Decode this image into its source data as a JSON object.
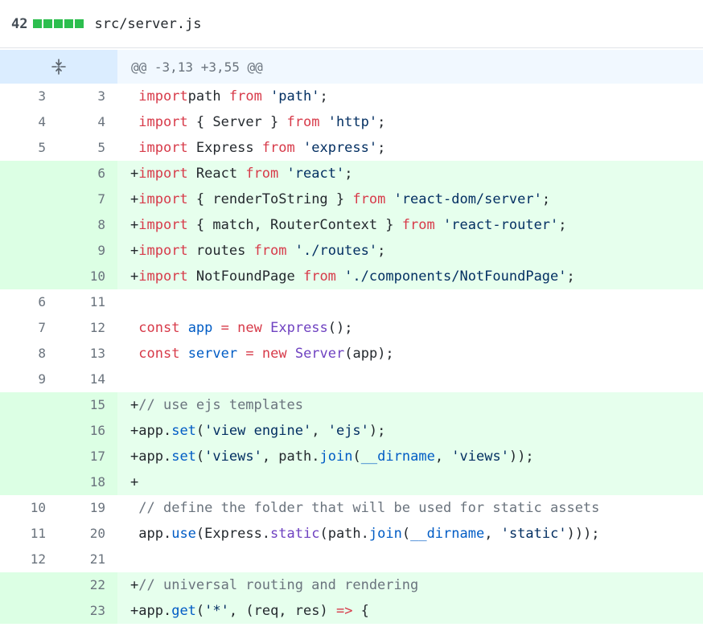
{
  "file": {
    "change_count": "42",
    "diffstat_blocks": 5,
    "diffstat_color": "#2cbe4e",
    "path": "src/server.js"
  },
  "hunk": {
    "header": "@@ -3,13 +3,55 @@",
    "expand_icon": "unfold-icon"
  },
  "colors": {
    "addition_bg": "#e6ffed",
    "addition_num_bg": "#dcffe4",
    "hunk_bg": "#f1f8ff",
    "keyword": "#d73a49",
    "string": "#032f62",
    "function": "#6f42c1",
    "comment": "#6a737d",
    "variable": "#005cc5"
  },
  "lines": [
    {
      "type": "ctx",
      "old": "3",
      "new": "3",
      "prefix": " ",
      "tokens": [
        [
          "k",
          "import"
        ],
        [
          "",
          "path "
        ],
        [
          "k",
          "from"
        ],
        [
          "",
          " "
        ],
        [
          "s",
          "'path'"
        ],
        [
          "",
          ";"
        ]
      ]
    },
    {
      "type": "ctx",
      "old": "4",
      "new": "4",
      "prefix": " ",
      "tokens": [
        [
          "k",
          "import"
        ],
        [
          "",
          " { Server } "
        ],
        [
          "k",
          "from"
        ],
        [
          "",
          " "
        ],
        [
          "s",
          "'http'"
        ],
        [
          "",
          ";"
        ]
      ]
    },
    {
      "type": "ctx",
      "old": "5",
      "new": "5",
      "prefix": " ",
      "tokens": [
        [
          "k",
          "import"
        ],
        [
          "",
          " Express "
        ],
        [
          "k",
          "from"
        ],
        [
          "",
          " "
        ],
        [
          "s",
          "'express'"
        ],
        [
          "",
          ";"
        ]
      ]
    },
    {
      "type": "add",
      "old": "",
      "new": "6",
      "prefix": "+",
      "tokens": [
        [
          "k",
          "import"
        ],
        [
          "",
          " React "
        ],
        [
          "k",
          "from"
        ],
        [
          "",
          " "
        ],
        [
          "s",
          "'react'"
        ],
        [
          "",
          ";"
        ]
      ]
    },
    {
      "type": "add",
      "old": "",
      "new": "7",
      "prefix": "+",
      "tokens": [
        [
          "k",
          "import"
        ],
        [
          "",
          " { renderToString } "
        ],
        [
          "k",
          "from"
        ],
        [
          "",
          " "
        ],
        [
          "s",
          "'react-dom/server'"
        ],
        [
          "",
          ";"
        ]
      ]
    },
    {
      "type": "add",
      "old": "",
      "new": "8",
      "prefix": "+",
      "tokens": [
        [
          "k",
          "import"
        ],
        [
          "",
          " { match, RouterContext } "
        ],
        [
          "k",
          "from"
        ],
        [
          "",
          " "
        ],
        [
          "s",
          "'react-router'"
        ],
        [
          "",
          ";"
        ]
      ]
    },
    {
      "type": "add",
      "old": "",
      "new": "9",
      "prefix": "+",
      "tokens": [
        [
          "k",
          "import"
        ],
        [
          "",
          " routes "
        ],
        [
          "k",
          "from"
        ],
        [
          "",
          " "
        ],
        [
          "s",
          "'./routes'"
        ],
        [
          "",
          ";"
        ]
      ]
    },
    {
      "type": "add",
      "old": "",
      "new": "10",
      "prefix": "+",
      "tokens": [
        [
          "k",
          "import"
        ],
        [
          "",
          " NotFoundPage "
        ],
        [
          "k",
          "from"
        ],
        [
          "",
          " "
        ],
        [
          "s",
          "'./components/NotFoundPage'"
        ],
        [
          "",
          ";"
        ]
      ]
    },
    {
      "type": "ctx",
      "old": "6",
      "new": "11",
      "prefix": " ",
      "tokens": []
    },
    {
      "type": "ctx",
      "old": "7",
      "new": "12",
      "prefix": " ",
      "tokens": [
        [
          "k",
          "const"
        ],
        [
          "",
          " "
        ],
        [
          "v",
          "app"
        ],
        [
          "",
          " "
        ],
        [
          "k",
          "="
        ],
        [
          "",
          " "
        ],
        [
          "k",
          "new"
        ],
        [
          "",
          " "
        ],
        [
          "f",
          "Express"
        ],
        [
          "",
          "();"
        ]
      ]
    },
    {
      "type": "ctx",
      "old": "8",
      "new": "13",
      "prefix": " ",
      "tokens": [
        [
          "k",
          "const"
        ],
        [
          "",
          " "
        ],
        [
          "v",
          "server"
        ],
        [
          "",
          " "
        ],
        [
          "k",
          "="
        ],
        [
          "",
          " "
        ],
        [
          "k",
          "new"
        ],
        [
          "",
          " "
        ],
        [
          "f",
          "Server"
        ],
        [
          "",
          "(app);"
        ]
      ]
    },
    {
      "type": "ctx",
      "old": "9",
      "new": "14",
      "prefix": " ",
      "tokens": []
    },
    {
      "type": "add",
      "old": "",
      "new": "15",
      "prefix": "+",
      "tokens": [
        [
          "c",
          "// use ejs templates"
        ]
      ]
    },
    {
      "type": "add",
      "old": "",
      "new": "16",
      "prefix": "+",
      "tokens": [
        [
          "",
          "app."
        ],
        [
          "v",
          "set"
        ],
        [
          "",
          "("
        ],
        [
          "s",
          "'view engine'"
        ],
        [
          "",
          ", "
        ],
        [
          "s",
          "'ejs'"
        ],
        [
          "",
          ");"
        ]
      ]
    },
    {
      "type": "add",
      "old": "",
      "new": "17",
      "prefix": "+",
      "tokens": [
        [
          "",
          "app."
        ],
        [
          "v",
          "set"
        ],
        [
          "",
          "("
        ],
        [
          "s",
          "'views'"
        ],
        [
          "",
          ", path."
        ],
        [
          "v",
          "join"
        ],
        [
          "",
          "("
        ],
        [
          "v",
          "__dirname"
        ],
        [
          "",
          ", "
        ],
        [
          "s",
          "'views'"
        ],
        [
          "",
          "));"
        ]
      ]
    },
    {
      "type": "add",
      "old": "",
      "new": "18",
      "prefix": "+",
      "tokens": []
    },
    {
      "type": "ctx",
      "old": "10",
      "new": "19",
      "prefix": " ",
      "tokens": [
        [
          "c",
          "// define the folder that will be used for static assets"
        ]
      ]
    },
    {
      "type": "ctx",
      "old": "11",
      "new": "20",
      "prefix": " ",
      "tokens": [
        [
          "",
          "app."
        ],
        [
          "v",
          "use"
        ],
        [
          "",
          "(Express."
        ],
        [
          "f",
          "static"
        ],
        [
          "",
          "(path."
        ],
        [
          "v",
          "join"
        ],
        [
          "",
          "("
        ],
        [
          "v",
          "__dirname"
        ],
        [
          "",
          ", "
        ],
        [
          "s",
          "'static'"
        ],
        [
          "",
          ")));"
        ]
      ]
    },
    {
      "type": "ctx",
      "old": "12",
      "new": "21",
      "prefix": " ",
      "tokens": []
    },
    {
      "type": "add",
      "old": "",
      "new": "22",
      "prefix": "+",
      "tokens": [
        [
          "c",
          "// universal routing and rendering"
        ]
      ]
    },
    {
      "type": "add",
      "old": "",
      "new": "23",
      "prefix": "+",
      "tokens": [
        [
          "",
          "app."
        ],
        [
          "v",
          "get"
        ],
        [
          "",
          "("
        ],
        [
          "s",
          "'*'"
        ],
        [
          "",
          ", (req, res) "
        ],
        [
          "k",
          "=>"
        ],
        [
          "",
          " {"
        ]
      ]
    }
  ]
}
